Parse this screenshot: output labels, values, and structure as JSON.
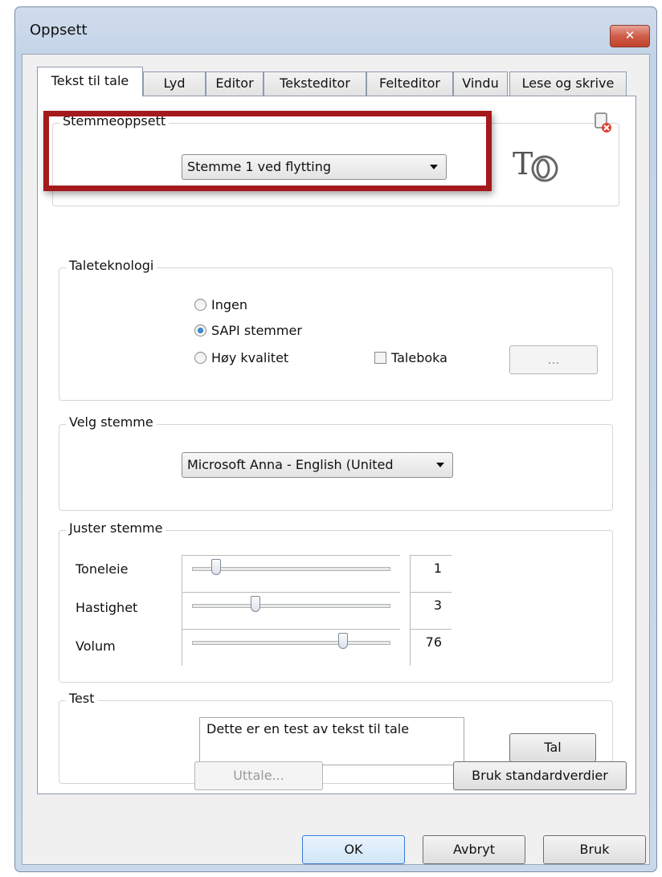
{
  "window": {
    "title": "Oppsett",
    "close_glyph": "✕"
  },
  "tabs": [
    {
      "label": "Tekst til tale",
      "active": true
    },
    {
      "label": "Lyd"
    },
    {
      "label": "Editor"
    },
    {
      "label": "Teksteditor"
    },
    {
      "label": "Felteditor"
    },
    {
      "label": "Vindu"
    },
    {
      "label": "Lese og skrive"
    }
  ],
  "stemmeoppsett": {
    "label": "Stemmeoppsett",
    "selected": "Stemme 1 ved flytting",
    "logo_text": "T"
  },
  "taleteknologi": {
    "label": "Taleteknologi",
    "options": [
      "Ingen",
      "SAPI stemmer",
      "Høy kvalitet"
    ],
    "selected": "SAPI stemmer",
    "taleboka_label": "Taleboka",
    "taleboka_checked": false,
    "more_button": "..."
  },
  "velg_stemme": {
    "label": "Velg stemme",
    "selected": "Microsoft Anna - English (United"
  },
  "juster_stemme": {
    "label": "Juster stemme",
    "sliders": [
      {
        "label": "Toneleie",
        "value": "1",
        "fraction": 0.12
      },
      {
        "label": "Hastighet",
        "value": "3",
        "fraction": 0.32
      },
      {
        "label": "Volum",
        "value": "76",
        "fraction": 0.76
      }
    ]
  },
  "test": {
    "label": "Test",
    "text": "Dette er en test av tekst til tale",
    "speak_button": "Tal"
  },
  "panel_buttons": {
    "pronounce": "Uttale...",
    "defaults": "Bruk standardverdier"
  },
  "dialog_buttons": {
    "ok": "OK",
    "cancel": "Avbryt",
    "apply": "Bruk"
  },
  "colors": {
    "highlight": "#a4191c",
    "close": "#c2422d"
  }
}
